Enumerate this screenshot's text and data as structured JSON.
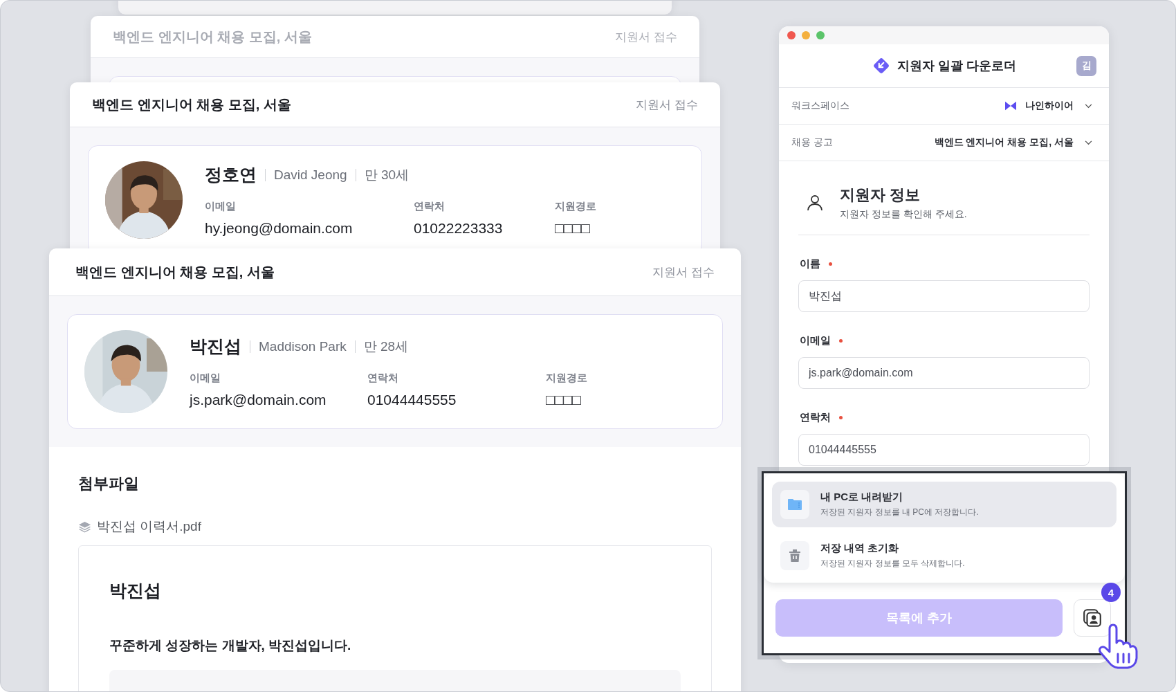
{
  "cards": [
    {
      "title": "백엔드 엔지니어 채용 모집, 서울",
      "status": "지원서 접수"
    },
    {
      "title": "백엔드 엔지니어 채용 모집, 서울",
      "status": "지원서 접수",
      "applicant": {
        "name": "정호연",
        "english_name": "David Jeong",
        "age": "만 30세",
        "fields": [
          {
            "label": "이메일",
            "value": "hy.jeong@domain.com"
          },
          {
            "label": "연락처",
            "value": "01022223333"
          },
          {
            "label": "지원경로",
            "value": "□□□□"
          }
        ]
      }
    },
    {
      "title": "백엔드 엔지니어 채용 모집, 서울",
      "status": "지원서 접수",
      "applicant": {
        "name": "박진섭",
        "english_name": "Maddison Park",
        "age": "만 28세",
        "fields": [
          {
            "label": "이메일",
            "value": "js.park@domain.com"
          },
          {
            "label": "연락처",
            "value": "01044445555"
          },
          {
            "label": "지원경로",
            "value": "□□□□"
          }
        ]
      },
      "attachments": {
        "heading": "첨부파일",
        "file": "박진섭 이력서.pdf",
        "document": {
          "name": "박진섭",
          "headline": "꾸준하게 성장하는 개발자, 박진섭입니다."
        }
      }
    }
  ],
  "app": {
    "title": "지원자 일괄 다운로더",
    "user_initial": "김",
    "selectors": [
      {
        "label": "워크스페이스",
        "value": "나인하이어",
        "kind": "workspace"
      },
      {
        "label": "채용 공고",
        "value": "백엔드 엔지니어 채용 모집, 서울",
        "kind": "plain"
      }
    ],
    "section": {
      "title": "지원자 정보",
      "subtitle": "지원자 정보를 확인해 주세요."
    },
    "fields": [
      {
        "label": "이름",
        "required": true,
        "value": "박진섭"
      },
      {
        "label": "이메일",
        "required": true,
        "value": "js.park@domain.com"
      },
      {
        "label": "연락처",
        "required": true,
        "value": "01044445555"
      }
    ],
    "menu": [
      {
        "kind": "download",
        "title": "내 PC로 내려받기",
        "description": "저장된 지원자 정보를 내 PC에 저장합니다.",
        "selected": true
      },
      {
        "kind": "reset",
        "title": "저장 내역 초기화",
        "description": "저장된 지원자 정보를 모두 삭제합니다.",
        "selected": false
      }
    ],
    "add_button": "목록에 추가",
    "saved_count": "4"
  }
}
